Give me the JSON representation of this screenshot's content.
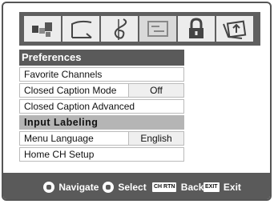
{
  "menu": {
    "title": "Preferences",
    "items": [
      {
        "label": "Favorite Channels",
        "value": ""
      },
      {
        "label": "Closed Caption Mode",
        "value": "Off"
      },
      {
        "label": "Closed Caption Advanced",
        "value": ""
      },
      {
        "label": "Input Labeling",
        "value": "",
        "highlighted": true
      },
      {
        "label": "Menu Language",
        "value": "English"
      },
      {
        "label": "Home CH Setup",
        "value": ""
      }
    ]
  },
  "icons": [
    "picture-icon",
    "screen-icon",
    "audio-icon",
    "preferences-icon",
    "lock-icon",
    "setup-icon"
  ],
  "footer": {
    "navigate": "Navigate",
    "select": "Select",
    "ch_rtn_key": "CH RTN",
    "back": "Back",
    "exit_key": "EXIT",
    "exit": "Exit"
  }
}
